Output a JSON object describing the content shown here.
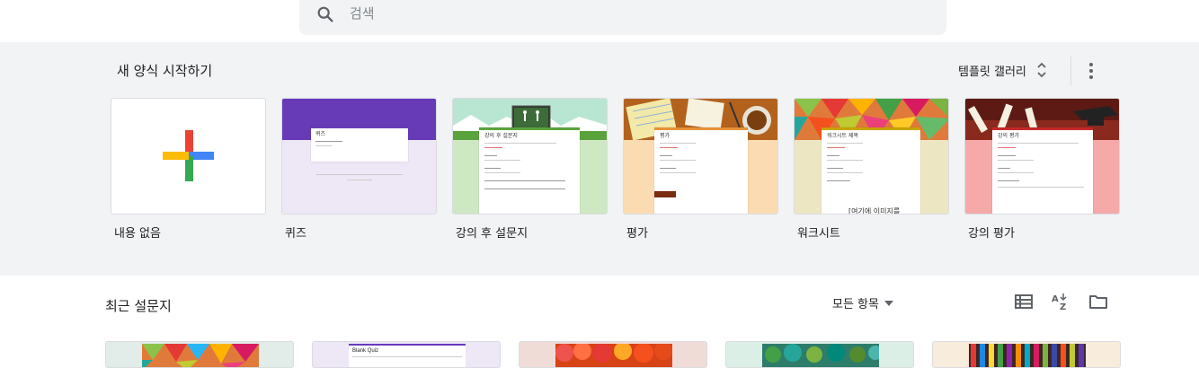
{
  "search": {
    "placeholder": "검색"
  },
  "templates": {
    "title": "새 양식 시작하기",
    "gallery_label": "템플릿 갤러리",
    "items": [
      {
        "label": "내용 없음"
      },
      {
        "label": "퀴즈",
        "form_title": "퀴즈",
        "color": "#673ab7"
      },
      {
        "label": "강의 후 설문지",
        "form_title": "강의 후 설문지",
        "color": "#cfe8c4"
      },
      {
        "label": "평가",
        "form_title": "평가",
        "color": "#fbdcb2"
      },
      {
        "label": "워크시트",
        "form_title": "워크시트 제목",
        "footer": "[여기에 이미지를",
        "color": "#ede6c2"
      },
      {
        "label": "강의 평가",
        "form_title": "강의 평가",
        "color": "#f5a9a9"
      }
    ]
  },
  "recent": {
    "title": "최근 설문지",
    "filter_label": "모든 항목",
    "docs": [
      {
        "name": "",
        "color": "#e2ece9"
      },
      {
        "name": "Blank Quiz",
        "color": "#ede7f6"
      },
      {
        "name": "",
        "color": "#f0dcd7"
      },
      {
        "name": "",
        "color": "#dcefe7"
      },
      {
        "name": "",
        "color": "#f8ecdc"
      }
    ]
  },
  "icons": {
    "search": "search-icon",
    "sort_toggle": "unfold-icon",
    "more": "more-vert-icon",
    "list_view": "list-view-icon",
    "sort_az": "sort-az-icon",
    "folder": "folder-icon"
  }
}
